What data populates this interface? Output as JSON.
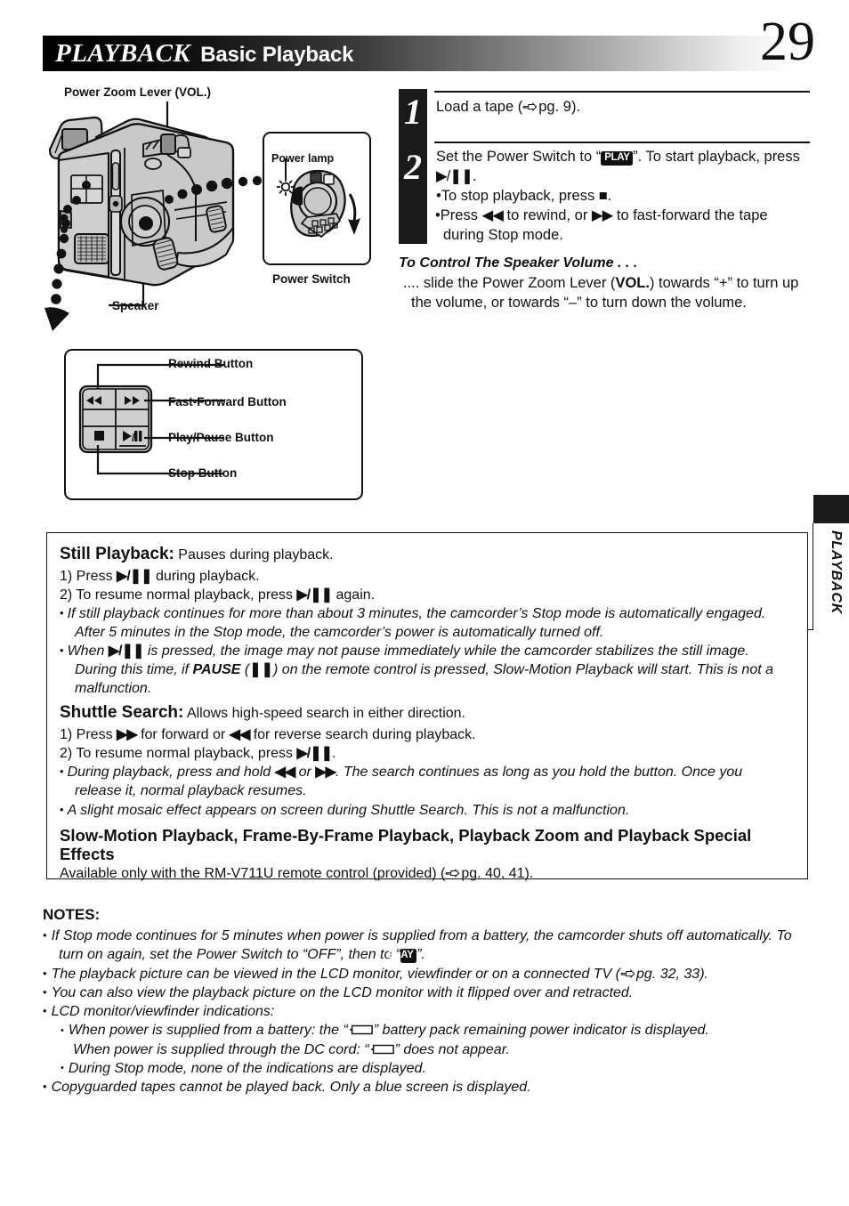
{
  "header": {
    "section": "PLAYBACK",
    "subsection": "Basic Playback",
    "page_number": "29",
    "side_tab": "PLAYBACK"
  },
  "illustration": {
    "zoom_lever_label": "Power Zoom Lever (VOL.)",
    "speaker_label": "Speaker",
    "power_lamp_label": "Power lamp",
    "power_switch_label": "Power Switch",
    "buttons": {
      "rewind_label": "Rewind Button",
      "fast_forward_label": "Fast-Forward Button",
      "play_pause_label": "Play/Pause Button",
      "stop_label": "Stop Button"
    }
  },
  "steps": [
    {
      "number": "1",
      "text": "Load a tape (",
      "ref": "pg. 9",
      "text_end": ")."
    },
    {
      "number": "2",
      "line1_a": "Set the Power Switch to “",
      "badge": "PLAY",
      "line1_b": "”. To start playback, press ",
      "line1_c": ".",
      "bullet1_a": "To stop playback, press ",
      "bullet1_b": ".",
      "bullet2_a": "Press ",
      "bullet2_b": " to rewind, or ",
      "bullet2_c": " to fast-forward the tape during Stop mode."
    }
  ],
  "volume": {
    "heading": "To Control The Speaker Volume . . .",
    "body_a": ".... slide the Power Zoom Lever (",
    "body_bold": "VOL.",
    "body_b": ") towards “+” to turn up the volume, or towards “–” to turn down the volume."
  },
  "main_box": {
    "still": {
      "title": "Still Playback:",
      "subtitle": "Pauses during playback.",
      "step1_a": "1) Press ",
      "step1_b": " during playback.",
      "step2_a": "2) To resume normal playback, press ",
      "step2_b": " again.",
      "bullet1": "If still playback continues for more than about 3 minutes, the camcorder’s Stop mode is automatically engaged. After 5 minutes in the Stop mode, the camcorder’s power is automatically turned off.",
      "bullet2_a": "When ",
      "bullet2_b": " is pressed, the image may not pause immediately while the camcorder stabilizes the still image. During this time, if ",
      "bullet2_bold": "PAUSE",
      "bullet2_c": " (",
      "bullet2_d": ") on the remote control is pressed, Slow-Motion Playback will start. This is not a malfunction."
    },
    "shuttle": {
      "title": "Shuttle Search:",
      "subtitle": "Allows high-speed search in either direction.",
      "step1_a": "1) Press ",
      "step1_b": " for forward or ",
      "step1_c": " for reverse search during playback.",
      "step2_a": "2) To resume normal playback, press ",
      "step2_b": ".",
      "bullet1_a": "During playback, press and hold ",
      "bullet1_b": " or ",
      "bullet1_c": ". The search continues as long as you hold the button. Once you release it, normal playback resumes.",
      "bullet2": "A slight mosaic effect appears on screen during Shuttle Search. This is not a malfunction."
    },
    "slow": {
      "heading": "Slow-Motion Playback, Frame-By-Frame Playback, Playback Zoom and Playback Special Effects",
      "body_a": "Available only with the RM-V711U remote control (provided) (",
      "body_ref": "pg. 40, 41",
      "body_b": ")."
    }
  },
  "notes": {
    "title": "NOTES:",
    "items": [
      {
        "text_a": "If Stop mode continues for 5 minutes when power is supplied from a battery, the camcorder shuts off automatically. To turn on again, set the Power Switch to “OFF”, then to “",
        "badge": "PLAY",
        "text_b": "”."
      },
      {
        "text_a": "The playback picture can be viewed in the LCD monitor, viewfinder or on a connected TV (",
        "ref": "pg. 32, 33",
        "text_b": ")."
      },
      {
        "text_a": "You can also view the playback picture on the LCD monitor with it flipped over and retracted."
      },
      {
        "text_a": "LCD monitor/viewfinder indications:"
      }
    ],
    "sub_items": [
      {
        "text_a": "When power is supplied from a battery: the “",
        "text_b": "” battery pack remaining power indicator is displayed.",
        "cont_a": "When power is supplied through the DC cord: “",
        "cont_b": "” does not appear."
      },
      {
        "text_a": "During Stop mode, none of the indications are displayed."
      }
    ],
    "last": {
      "text_a": "Copyguarded tapes cannot be played back. Only a blue screen is displayed."
    }
  },
  "colors": {
    "ink": "#111111",
    "paper": "#ffffff",
    "illustration_fill": "#c9c9c9"
  }
}
